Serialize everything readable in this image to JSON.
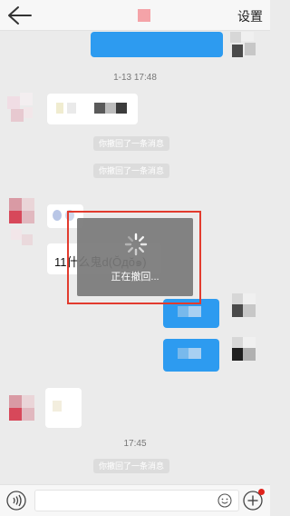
{
  "header": {
    "settings_label": "设置"
  },
  "chat": {
    "time_1": "1-13 17:48",
    "recalled_1": "你撤回了一条消息",
    "recalled_2": "你撤回了一条消息",
    "message_text": "11什么鬼d(Ŏдŏ๑)",
    "time_2": "17:45",
    "recalled_3": "你撤回了一条消息"
  },
  "overlay": {
    "loading_label": "正在撤回..."
  },
  "colors": {
    "accent_blue": "#2d9bf0",
    "highlight_red": "#e23b2e",
    "badge_red": "#e0231c"
  },
  "icons": [
    "back-arrow-icon",
    "voice-icon",
    "emoji-icon",
    "plus-icon",
    "spinner-icon"
  ]
}
